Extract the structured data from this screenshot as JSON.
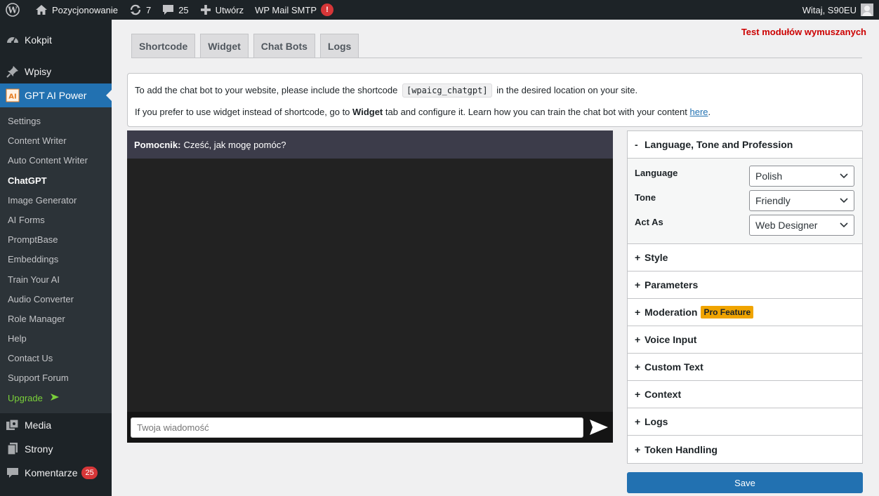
{
  "adminbar": {
    "site_name": "Pozycjonowanie",
    "updates_count": "7",
    "comments_count": "25",
    "new_label": "Utwórz",
    "smtp_label": "WP Mail SMTP",
    "smtp_alert": "!",
    "greeting": "Witaj, S90EU"
  },
  "sidebar": {
    "dashboard": "Kokpit",
    "posts": "Wpisy",
    "gpt_ai_power": "GPT AI Power",
    "submenu": [
      "Settings",
      "Content Writer",
      "Auto Content Writer",
      "ChatGPT",
      "Image Generator",
      "AI Forms",
      "PromptBase",
      "Embeddings",
      "Train Your AI",
      "Audio Converter",
      "Role Manager",
      "Help",
      "Contact Us",
      "Support Forum",
      "Upgrade"
    ],
    "media": "Media",
    "pages": "Strony",
    "comments": "Komentarze",
    "comments_badge": "25"
  },
  "notice": "Test modułów wymuszanych",
  "tabs": [
    "Shortcode",
    "Widget",
    "Chat Bots",
    "Logs"
  ],
  "info": {
    "line1_before": "To add the chat bot to your website, please include the shortcode",
    "shortcode": "[wpaicg_chatgpt]",
    "line1_after": "in the desired location on your site.",
    "line2_before": "If you prefer to use widget instead of shortcode, go to",
    "line2_widget": "Widget",
    "line2_middle": "tab and configure it. Learn how you can train the chat bot with your content",
    "line2_link": "here",
    "line2_end": "."
  },
  "chat": {
    "bot_name": "Pomocnik:",
    "bot_message": "Cześć, jak mogę pomóc?",
    "input_placeholder": "Twoja wiadomość"
  },
  "settings": {
    "open_section": "Language, Tone and Profession",
    "open_sign": "-",
    "fields": [
      {
        "label": "Language",
        "value": "Polish"
      },
      {
        "label": "Tone",
        "value": "Friendly"
      },
      {
        "label": "Act As",
        "value": "Web Designer"
      }
    ],
    "sections": [
      "Style",
      "Parameters",
      "Moderation",
      "Voice Input",
      "Custom Text",
      "Context",
      "Logs",
      "Token Handling"
    ],
    "closed_sign": "+",
    "pro_badge": "Pro Feature",
    "save_label": "Save"
  },
  "colors": {
    "admin_bg": "#1d2327",
    "accent": "#2271b1",
    "notice": "#cc0000",
    "pro_badge": "#f0a400",
    "chat_bg": "#222222",
    "chat_header": "#3c3c4a"
  },
  "icons": [
    "wordpress-logo-icon",
    "home-icon",
    "updates-icon",
    "comments-icon",
    "plus-icon",
    "alert-icon",
    "avatar-icon",
    "dashboard-icon",
    "pin-icon",
    "gpt-ai-power-icon",
    "media-icon",
    "pages-icon",
    "comment-icon",
    "send-icon",
    "chevron-down-icon",
    "upgrade-arrow-icon"
  ]
}
